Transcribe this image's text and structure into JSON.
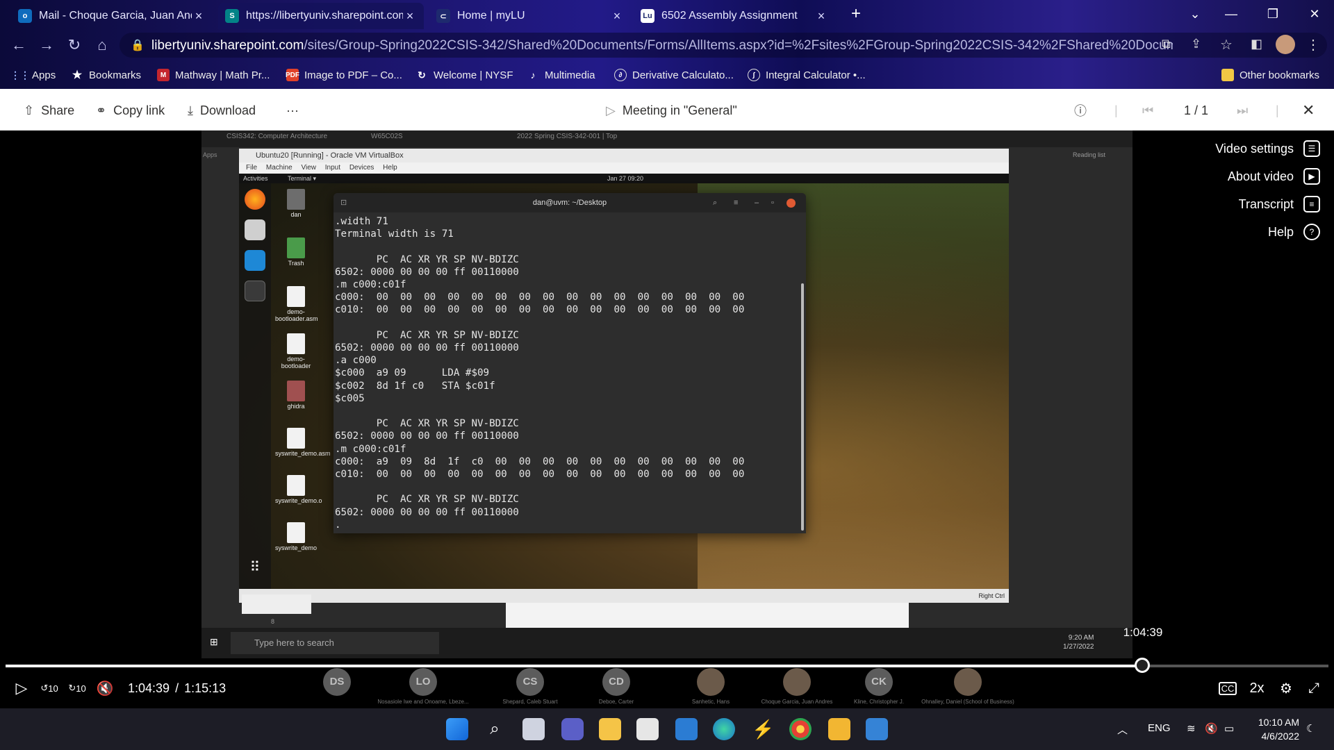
{
  "browser": {
    "tabs": [
      {
        "label": "Mail - Choque Garcia, Juan Andr",
        "icon_color": "#0f6cbd"
      },
      {
        "label": "https://libertyuniv.sharepoint.com",
        "icon_color": "#038387"
      },
      {
        "label": "Home | myLU",
        "icon_color": "#1e2a6e"
      },
      {
        "label": "6502 Assembly Assignment",
        "icon_color": "#ffffff"
      }
    ],
    "url_host": "libertyuniv.sharepoint.com",
    "url_path": "/sites/Group-Spring2022CSIS-342/Shared%20Documents/Forms/AllItems.aspx?id=%2Fsites%2FGroup-Spring2022CSIS-342%2FShared%20Documents%2FGen...",
    "bookmarks": [
      {
        "label": "Apps",
        "icon": "apps-grid-icon"
      },
      {
        "label": "Bookmarks",
        "icon": "star-icon"
      },
      {
        "label": "Mathway | Math Pr...",
        "icon": "mathway-icon"
      },
      {
        "label": "Image to PDF – Co...",
        "icon": "pdf-icon"
      },
      {
        "label": "Welcome | NYSF",
        "icon": "nysf-icon"
      },
      {
        "label": "Multimedia",
        "icon": "multimedia-icon"
      },
      {
        "label": "Derivative Calculato...",
        "icon": "calculator-icon"
      },
      {
        "label": "Integral Calculator •...",
        "icon": "calculator-icon"
      },
      {
        "label": "Other bookmarks",
        "icon": "folder-icon"
      }
    ]
  },
  "viewer": {
    "share": "Share",
    "copy_link": "Copy link",
    "download": "Download",
    "more": "···",
    "title": "Meeting in \"General\"",
    "page": "1 / 1",
    "side_menu": [
      "Video settings",
      "About video",
      "Transcript",
      "Help"
    ]
  },
  "shared_screen": {
    "host_tabs": [
      "CSIS342: Computer Architecture",
      "W65C02S",
      "2022 Spring CSIS-342-001 | Top"
    ],
    "vm_title": "Ubuntu20 [Running] - Oracle VM VirtualBox",
    "vm_menu": [
      "File",
      "Machine",
      "View",
      "Input",
      "Devices",
      "Help"
    ],
    "gnome_activities": "Activities",
    "gnome_app": "Terminal ▾",
    "gnome_clock": "Jan 27  09:20",
    "desktop_icons": [
      "dan",
      "Trash",
      "demo-bootloader.asm",
      "demo-bootloader",
      "ghidra",
      "syswrite_demo.asm",
      "syswrite_demo.o",
      "syswrite_demo"
    ],
    "terminal_title": "dan@uvm: ~/Desktop",
    "terminal_lines": [
      ".width 71",
      "Terminal width is 71",
      "",
      "       PC  AC XR YR SP NV-BDIZC",
      "6502: 0000 00 00 00 ff 00110000",
      ".m c000:c01f",
      "c000:  00  00  00  00  00  00  00  00  00  00  00  00  00  00  00  00",
      "c010:  00  00  00  00  00  00  00  00  00  00  00  00  00  00  00  00",
      "",
      "       PC  AC XR YR SP NV-BDIZC",
      "6502: 0000 00 00 00 ff 00110000",
      ".a c000",
      "$c000  a9 09      LDA #$09",
      "$c002  8d 1f c0   STA $c01f",
      "$c005",
      "",
      "       PC  AC XR YR SP NV-BDIZC",
      "6502: 0000 00 00 00 ff 00110000",
      ".m c000:c01f",
      "c000:  a9  09  8d  1f  c0  00  00  00  00  00  00  00  00  00  00  00",
      "c010:  00  00  00  00  00  00  00  00  00  00  00  00  00  00  00  00",
      "",
      "       PC  AC XR YR SP NV-BDIZC",
      "6502: 0000 00 00 00 ff 00110000",
      "."
    ],
    "vbox_status": "Right Ctrl",
    "taskbar_search": "Type here to search",
    "taskbar_time": "9:20 AM",
    "taskbar_date": "1/27/2022",
    "reading_list": "Reading list",
    "apps_label": "Apps",
    "page_number": "8"
  },
  "player": {
    "current_time": "1:04:39",
    "duration": "1:15:13",
    "tooltip_time": "1:04:39",
    "progress_fraction": 0.8594,
    "speed": "2x",
    "skip_back": "10",
    "skip_forward": "10",
    "participants": [
      {
        "initials": "DS",
        "name": ""
      },
      {
        "initials": "LO",
        "name": "Nosasiole Iwe and Onoame, Lbeze..."
      },
      {
        "initials": "CS",
        "name": "Shepard, Caleb Stuart"
      },
      {
        "initials": "CD",
        "name": "Deboe, Carter"
      },
      {
        "initials": "",
        "name": "Sanhetic, Hans"
      },
      {
        "initials": "",
        "name": "Choque Garcia, Juan Andres"
      },
      {
        "initials": "CK",
        "name": "Kline, Christopher J."
      },
      {
        "initials": "",
        "name": "Ohnalley, Daniel (School of Business)"
      }
    ]
  },
  "taskbar": {
    "lang": "ENG",
    "time": "10:10 AM",
    "date": "4/6/2022"
  }
}
